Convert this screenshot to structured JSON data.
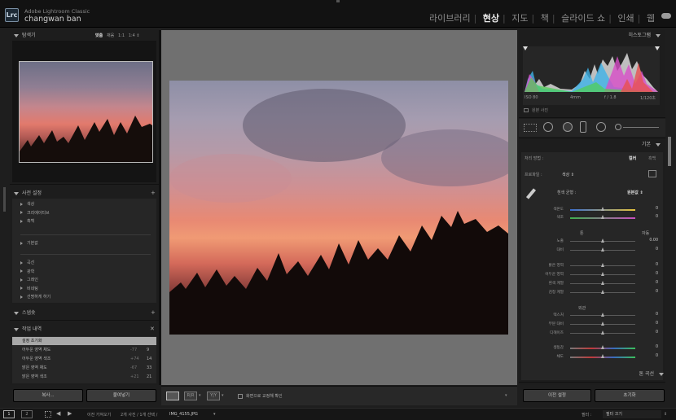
{
  "app": {
    "name": "Adobe Lightroom Classic",
    "user": "changwan ban",
    "logo": "Lrc"
  },
  "modules": [
    {
      "label": "라이브러리",
      "active": false
    },
    {
      "label": "현상",
      "active": true
    },
    {
      "label": "지도",
      "active": false
    },
    {
      "label": "책",
      "active": false
    },
    {
      "label": "슬라이드 쇼",
      "active": false
    },
    {
      "label": "인쇄",
      "active": false
    },
    {
      "label": "웹",
      "active": false
    }
  ],
  "navigator": {
    "title": "탐색기",
    "modes": [
      "맞춤",
      "채움",
      "1:1",
      "1:4"
    ]
  },
  "presets": {
    "title": "사전 설정",
    "groups_a": [
      "색상",
      "크리에이티브",
      "흑백"
    ],
    "groups_b": [
      "기본값"
    ],
    "groups_c": [
      "곡선",
      "광학",
      "그레인",
      "비네팅",
      "선명하게 하기"
    ]
  },
  "snapshots": {
    "title": "스냅숏"
  },
  "history": {
    "title": "작업 내역",
    "rows": [
      {
        "label": "설정 초기화",
        "delta": "",
        "value": ""
      },
      {
        "label": "어두운 영역 채도",
        "delta": "-77",
        "value": "9"
      },
      {
        "label": "어두운 영역 색조",
        "delta": "+74",
        "value": "14"
      },
      {
        "label": "밝은 영역 채도",
        "delta": "-67",
        "value": "33"
      },
      {
        "label": "밝은 영역 색조",
        "delta": "+21",
        "value": "21"
      }
    ]
  },
  "left_buttons": {
    "copy": "복사...",
    "paste": "붙여넣기"
  },
  "toolbar": {
    "loupe_overlay": "화면으로 교정해 확인"
  },
  "histogram": {
    "title": "히스토그램",
    "iso": "ISO 80",
    "focal": "4mm",
    "aperture": "f / 1.8",
    "shutter": "1/120초",
    "original_photo": "원본 사진"
  },
  "basic": {
    "title": "기본",
    "treatment_label": "처리 방법 :",
    "treatment_color": "컬러",
    "treatment_bw": "흑백",
    "profile_label": "프로파일 :",
    "profile_value": "색상 ⇕",
    "wb_label": "흰색 균형 :",
    "wb_value": "원본값 ⇕",
    "tone_label": "톤",
    "tone_auto": "자동",
    "presence_label": "외관",
    "sliders": [
      {
        "label": "색온도",
        "value": "0",
        "pos": 0.5,
        "grad": "temp"
      },
      {
        "label": "색조",
        "value": "0",
        "pos": 0.5,
        "grad": "tint"
      },
      {
        "label": "노출",
        "value": "0.00",
        "pos": 0.5,
        "grad": ""
      },
      {
        "label": "대비",
        "value": "0",
        "pos": 0.5,
        "grad": ""
      },
      {
        "label": "밝은 영역",
        "value": "0",
        "pos": 0.5,
        "grad": ""
      },
      {
        "label": "어두운 영역",
        "value": "0",
        "pos": 0.5,
        "grad": ""
      },
      {
        "label": "흰색 계열",
        "value": "0",
        "pos": 0.5,
        "grad": ""
      },
      {
        "label": "검정 계열",
        "value": "0",
        "pos": 0.5,
        "grad": ""
      },
      {
        "label": "텍스처",
        "value": "0",
        "pos": 0.5,
        "grad": ""
      },
      {
        "label": "부분 대비",
        "value": "0",
        "pos": 0.5,
        "grad": ""
      },
      {
        "label": "디헤이즈",
        "value": "0",
        "pos": 0.5,
        "grad": ""
      },
      {
        "label": "생동감",
        "value": "0",
        "pos": 0.5,
        "grad": "sat"
      },
      {
        "label": "채도",
        "value": "0",
        "pos": 0.5,
        "grad": "sat"
      }
    ]
  },
  "tonecurve": {
    "title": "톤 곡선"
  },
  "right_buttons": {
    "previous": "이전 설정",
    "reset": "초기화"
  },
  "filmstrip": {
    "page1": "1",
    "page2": "2",
    "source": "이전 가져오기",
    "count": "2개 사진 / 1개 선택 /",
    "filename": "IMG_4155.JPG",
    "filter_label": "필터 :",
    "filter_value": "필터 끄기"
  }
}
